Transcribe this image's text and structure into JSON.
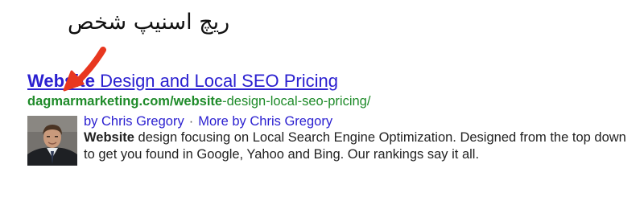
{
  "caption": "ریچ اسنیپ شخص",
  "result": {
    "title_bold": "Website",
    "title_rest": " Design and Local SEO Pricing",
    "url_domain": "dagmarmarketing.com/",
    "url_bold_path": "website",
    "url_rest": "-design-local-seo-pricing/",
    "author_link": "by Chris Gregory",
    "separator": "·",
    "more_link": "More by Chris Gregory",
    "snippet_bold": "Website",
    "snippet_rest": " design focusing on Local Search Engine Optimization. Designed from the top down to get you found in Google, Yahoo and Bing. Our rankings say it all."
  },
  "colors": {
    "link": "#2a1fd0",
    "url": "#1f8b2a",
    "arrow": "#e8371f"
  },
  "icons": {
    "avatar": "author-photo",
    "annotation": "red-arrow-icon"
  }
}
